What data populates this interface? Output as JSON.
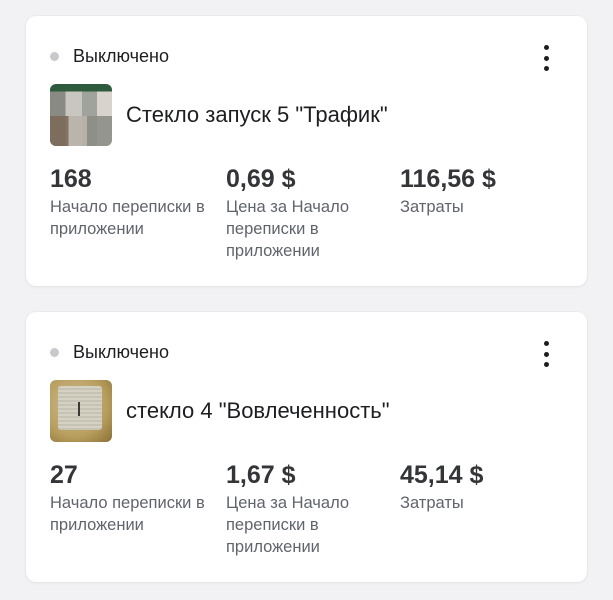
{
  "campaigns": [
    {
      "status": "Выключено",
      "name": "Стекло запуск 5 \"Трафик\"",
      "menu_icon": "more-vertical-icon",
      "metrics": [
        {
          "value": "168",
          "label": "Начало переписки в приложении"
        },
        {
          "value": "0,69 $",
          "label": "Цена за Начало переписки в приложении"
        },
        {
          "value": "116,56 $",
          "label": "Затраты"
        }
      ]
    },
    {
      "status": "Выключено",
      "name": "стекло 4 \"Вовлеченность\"",
      "menu_icon": "more-vertical-icon",
      "metrics": [
        {
          "value": "27",
          "label": "Начало переписки в приложении"
        },
        {
          "value": "1,67 $",
          "label": "Цена за Начало переписки в приложении"
        },
        {
          "value": "45,14 $",
          "label": "Затраты"
        }
      ]
    }
  ],
  "colors": {
    "status_dot_off": "#c8c9cc",
    "card_bg": "#ffffff",
    "page_bg": "#f2f2f4"
  }
}
